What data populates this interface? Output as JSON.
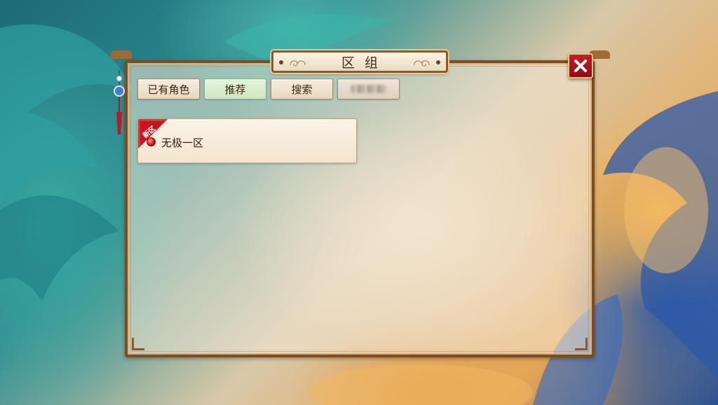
{
  "dialog": {
    "title": "区组",
    "close_icon": "close-x-icon",
    "accent_color": "#c3202a",
    "frame_color": "#7d4b24"
  },
  "tabs": [
    {
      "label": "已有角色",
      "active": false
    },
    {
      "label": "推荐",
      "active": true
    },
    {
      "label": "搜索",
      "active": false
    },
    {
      "label": "",
      "active": false,
      "obscured": true
    }
  ],
  "servers": [
    {
      "name": "无极一区",
      "badge": "新区",
      "status_color": "#d11a1a"
    }
  ]
}
